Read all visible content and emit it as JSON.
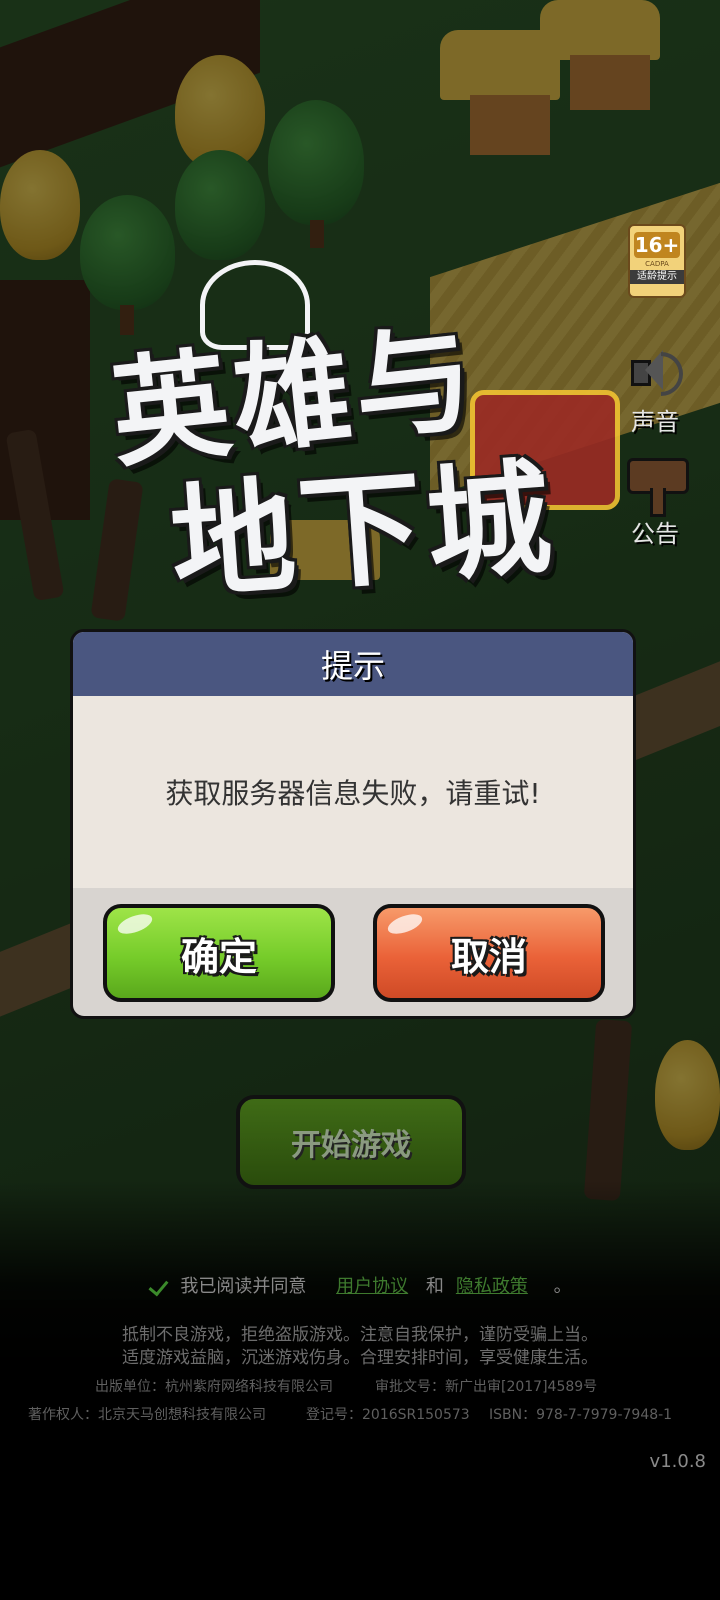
{
  "logo": {
    "line1": "英雄与",
    "line2": "地下城"
  },
  "age_rating": {
    "age": "16+",
    "org": "CADPA",
    "tip": "适龄提示"
  },
  "side_buttons": {
    "sound_label": "声音",
    "notice_label": "公告"
  },
  "start_button": {
    "label": "开始游戏"
  },
  "dialog": {
    "title": "提示",
    "message": "获取服务器信息失败，请重试!",
    "ok_label": "确定",
    "cancel_label": "取消"
  },
  "agreement": {
    "prefix": "我已阅读并同意",
    "user_agreement": "用户协议",
    "and": "和",
    "privacy_policy": "隐私政策",
    "suffix": "。"
  },
  "health_notice": {
    "line1": "抵制不良游戏，拒绝盗版游戏。注意自我保护，谨防受骗上当。",
    "line2": "适度游戏益脑，沉迷游戏伤身。合理安排时间，享受健康生活。"
  },
  "publisher": {
    "publisher": "出版单位：杭州紫府网络科技有限公司",
    "approval": "审批文号：新广出审[2017]4589号",
    "copyright": "著作权人：北京天马创想科技有限公司",
    "registration": "登记号：2016SR150573",
    "isbn": "ISBN：978-7-7979-7948-1"
  },
  "version": "v1.0.8",
  "colors": {
    "header": "#4a5680",
    "ok_button": "#76cc2a",
    "cancel_button": "#ea6238",
    "link": "#3e7a2e"
  }
}
